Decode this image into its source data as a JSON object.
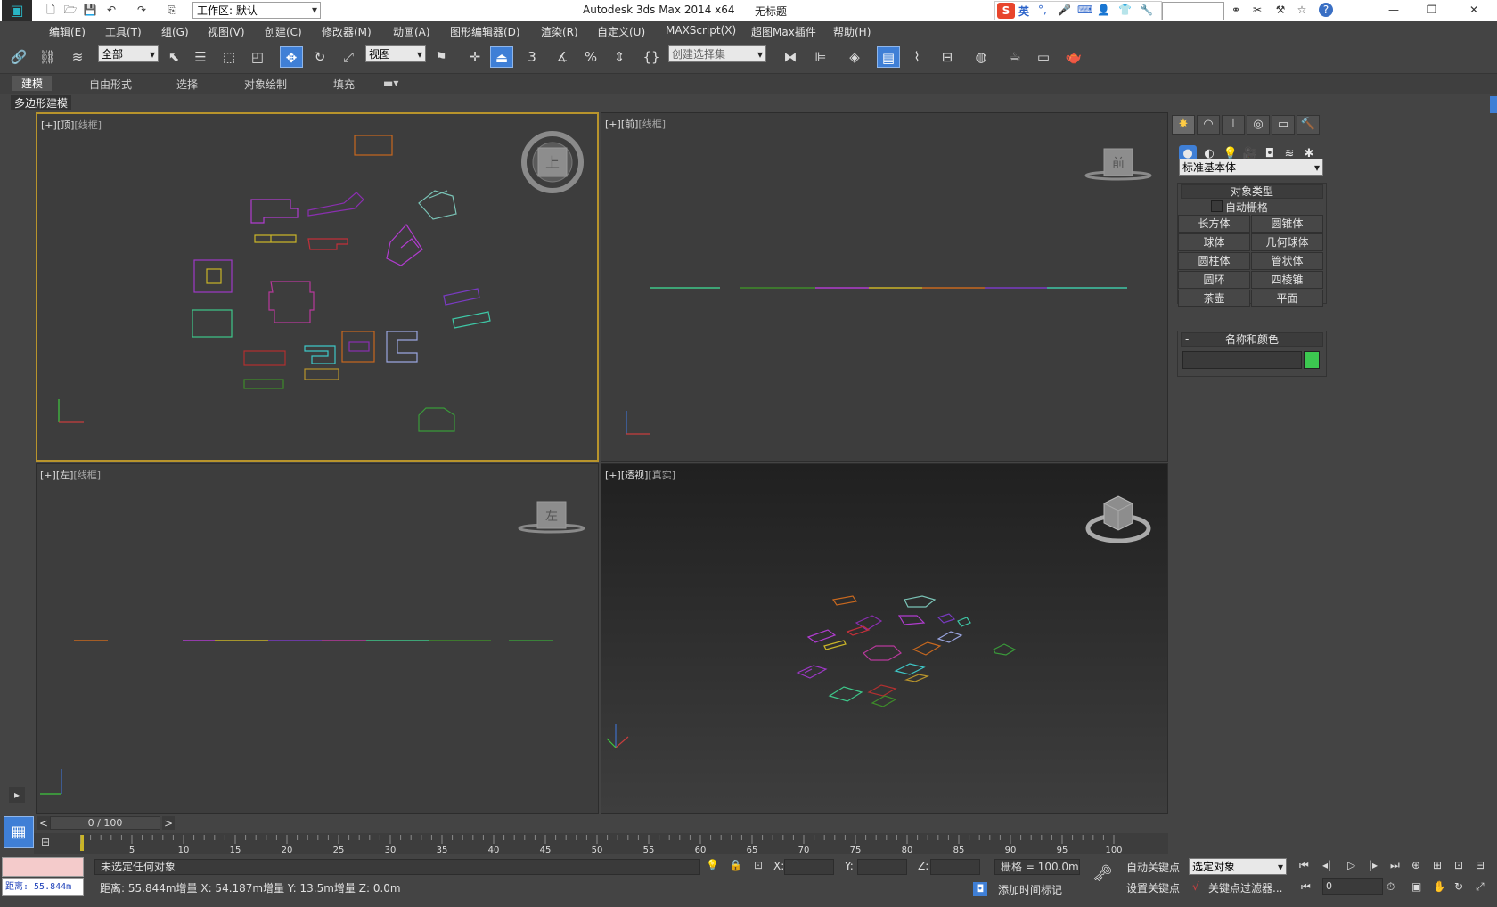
{
  "app": {
    "title": "Autodesk 3ds Max  2014 x64",
    "doc": "无标题",
    "workspace": "工作区: 默认"
  },
  "ime": {
    "lang": "英"
  },
  "menu": [
    "编辑(E)",
    "工具(T)",
    "组(G)",
    "视图(V)",
    "创建(C)",
    "修改器(M)",
    "动画(A)",
    "图形编辑器(D)",
    "渲染(R)",
    "自定义(U)",
    "MAXScript(X)",
    "超图Max插件",
    "帮助(H)"
  ],
  "toolbar": {
    "filter": "全部",
    "refcoord": "视图",
    "snap3": "3",
    "named_sel": "创建选择集"
  },
  "ribbon": {
    "tabs": [
      "建模",
      "自由形式",
      "选择",
      "对象绘制",
      "填充"
    ],
    "sub": "多边形建模"
  },
  "viewports": {
    "top": {
      "plus": "[+]",
      "name": "[顶]",
      "mode": "[线框]",
      "cube": "上"
    },
    "front": {
      "plus": "[+]",
      "name": "[前]",
      "mode": "[线框]",
      "cube": "前"
    },
    "left": {
      "plus": "[+]",
      "name": "[左]",
      "mode": "[线框]",
      "cube": "左"
    },
    "persp": {
      "plus": "[+]",
      "name": "[透视]",
      "mode": "[真实]",
      "cube": ""
    }
  },
  "command_panel": {
    "category": "标准基本体",
    "object_type_title": "对象类型",
    "autogrid": "自动栅格",
    "buttons": [
      "长方体",
      "圆锥体",
      "球体",
      "几何球体",
      "圆柱体",
      "管状体",
      "圆环",
      "四棱锥",
      "茶壶",
      "平面"
    ],
    "name_color_title": "名称和颜色",
    "swatch_color": "#3cc850"
  },
  "timeline": {
    "slider": "0 / 100",
    "ticks": [
      "5",
      "10",
      "15",
      "20",
      "25",
      "30",
      "35",
      "40",
      "45",
      "50",
      "55",
      "60",
      "65",
      "70",
      "75",
      "80",
      "85",
      "90",
      "95",
      "100"
    ]
  },
  "status": {
    "maxscript": "距离: 55.844m",
    "prompt1": "未选定任何对象",
    "prompt2": "距离: 55.844m增量 X: 54.187m增量 Y: 13.5m增量 Z: 0.0m",
    "x_label": "X:",
    "y_label": "Y:",
    "z_label": "Z:",
    "grid": "栅格 = 100.0m",
    "autokey": "自动关键点",
    "setkey": "设置关键点",
    "selection_set": "选定对象",
    "key_filters": "关键点过滤器...",
    "add_time_tag": "添加时间标记",
    "frame": "0"
  },
  "colors": {
    "selected_viewport_border": "#b8942c",
    "active_button": "#3f7fd6"
  }
}
